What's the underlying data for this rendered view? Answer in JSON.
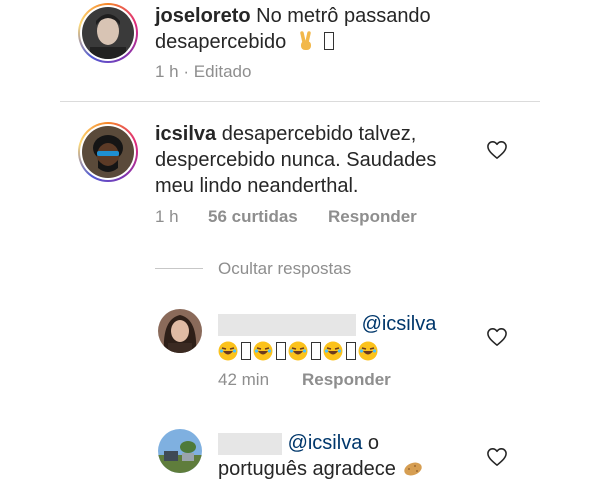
{
  "post": {
    "username": "joseloreto",
    "caption_line1": "No metrô passando",
    "caption_line2": "desapercebido",
    "time": "1 h",
    "separator": "·",
    "edited": "Editado"
  },
  "comment": {
    "username": "icsilva",
    "text_line1": "desapercebido talvez,",
    "text_line2": "despercebido nunca. Saudades",
    "text_line3": "meu lindo neanderthal.",
    "time": "1 h",
    "likes": "56 curtidas",
    "reply": "Responder"
  },
  "hide_replies": "Ocultar respostas",
  "replies": [
    {
      "mention": "@icsilva",
      "time": "42 min",
      "reply": "Responder"
    },
    {
      "mention": "@icsilva",
      "text_after": "o",
      "text_line2": "português agradece"
    }
  ],
  "icons": [
    "heart-outline-icon",
    "victory-hand-emoji",
    "laughing-emoji",
    "potato-emoji"
  ]
}
